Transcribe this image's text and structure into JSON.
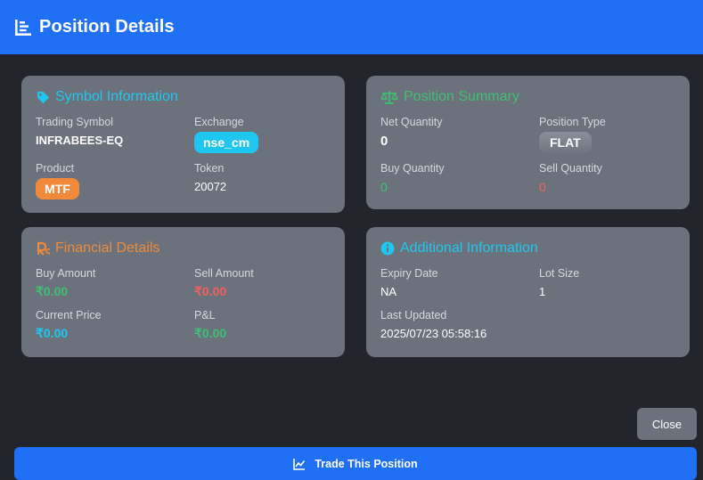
{
  "header": {
    "title": "Position Details",
    "icon": "list-chart-icon"
  },
  "symbol_info": {
    "title": "Symbol Information",
    "icon": "tag-icon",
    "trading_symbol_label": "Trading Symbol",
    "trading_symbol": "INFRABEES-EQ",
    "exchange_label": "Exchange",
    "exchange": "nse_cm",
    "product_label": "Product",
    "product": "MTF",
    "token_label": "Token",
    "token": "20072"
  },
  "position_summary": {
    "title": "Position Summary",
    "icon": "balance-scale-icon",
    "net_qty_label": "Net Quantity",
    "net_qty": "0",
    "position_type_label": "Position Type",
    "position_type": "FLAT",
    "buy_qty_label": "Buy Quantity",
    "buy_qty": "0",
    "sell_qty_label": "Sell Quantity",
    "sell_qty": "0"
  },
  "financial": {
    "title": "Financial Details",
    "icon": "rupee-icon",
    "buy_amount_label": "Buy Amount",
    "buy_amount": "₹0.00",
    "sell_amount_label": "Sell Amount",
    "sell_amount": "₹0.00",
    "current_price_label": "Current Price",
    "current_price": "₹0.00",
    "pnl_label": "P&L",
    "pnl": "₹0.00"
  },
  "additional": {
    "title": "Additional Information",
    "icon": "info-circle-icon",
    "expiry_label": "Expiry Date",
    "expiry": "NA",
    "lot_size_label": "Lot Size",
    "lot_size": "1",
    "last_updated_label": "Last Updated",
    "last_updated": "2025/07/23 05:58:16"
  },
  "buttons": {
    "close": "Close",
    "trade": "Trade This Position",
    "trade_icon": "line-chart-icon"
  },
  "colors": {
    "accent_blue": "#1f70f5",
    "cyan": "#1fc7f0",
    "green": "#3fbf74",
    "red": "#f0605f",
    "orange": "#f08a3a",
    "card": "#6b727c",
    "background": "#22262c"
  }
}
